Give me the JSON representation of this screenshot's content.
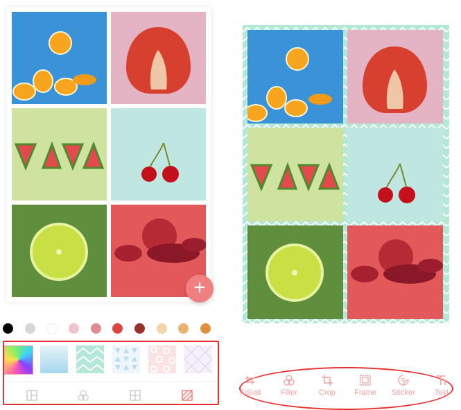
{
  "left_panel": {
    "photos": [
      {
        "subject": "orange slices",
        "bg": "#3a93d6"
      },
      {
        "subject": "strawberry half",
        "bg": "#e4b3c4"
      },
      {
        "subject": "watermelon slices",
        "bg": "#cfe3a1"
      },
      {
        "subject": "cherries",
        "bg": "#bfe6e0"
      },
      {
        "subject": "lime half",
        "bg": "#5f8f3c"
      },
      {
        "subject": "pomegranate",
        "bg": "#e3595a"
      }
    ],
    "add_button_label": "+",
    "colors": [
      "#000000",
      "#d6d6d6",
      "#ffffff",
      "#efc4cb",
      "#e08b90",
      "#d9463e",
      "#9b2f2c",
      "#f3d4a9",
      "#eab26c",
      "#e0913f"
    ],
    "backgrounds": [
      {
        "name": "rainbow gradient"
      },
      {
        "name": "blue gradient"
      },
      {
        "name": "mint zigzag"
      },
      {
        "name": "blue triangles"
      },
      {
        "name": "pink circles"
      },
      {
        "name": "lavender lattice"
      }
    ],
    "tabs": [
      {
        "icon": "layout-icon",
        "active": false
      },
      {
        "icon": "filter-icon",
        "active": false
      },
      {
        "icon": "grid-icon",
        "active": false
      },
      {
        "icon": "background-icon",
        "active": true
      }
    ],
    "accent": "#f08080"
  },
  "right_panel": {
    "frame_pattern": "mint zigzag",
    "toolbar": [
      {
        "label": "Adjust",
        "icon": "adjust-icon"
      },
      {
        "label": "Filter",
        "icon": "filter-icon"
      },
      {
        "label": "Crop",
        "icon": "crop-icon"
      },
      {
        "label": "Frame",
        "icon": "frame-icon"
      },
      {
        "label": "Sticker",
        "icon": "sticker-icon"
      },
      {
        "label": "Text",
        "icon": "text-icon"
      }
    ]
  }
}
